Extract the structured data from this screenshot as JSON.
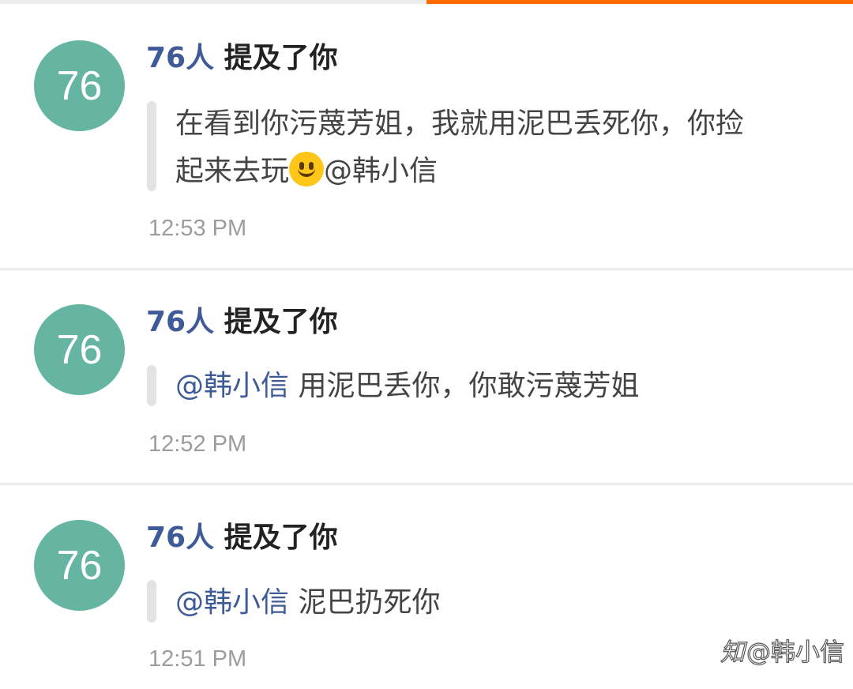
{
  "notifications": [
    {
      "avatar_text": "76",
      "user": "76人",
      "action": "提及了你",
      "message_lines": [
        "在看到你污蔑芳姐，我就用泥巴丢死你，你捡",
        "起来去玩"
      ],
      "message_emoji": "smiley-face",
      "message_suffix": "@韩小信",
      "time": "12:53 PM"
    },
    {
      "avatar_text": "76",
      "user": "76人",
      "action": "提及了你",
      "mention": "@韩小信",
      "message": " 用泥巴丢你，你敢污蔑芳姐",
      "time": "12:52 PM"
    },
    {
      "avatar_text": "76",
      "user": "76人",
      "action": "提及了你",
      "mention": "@韩小信",
      "message": " 泥巴扔死你",
      "time": "12:51 PM"
    }
  ],
  "watermark": {
    "logo": "知",
    "text": "@韩小信"
  },
  "colors": {
    "accent": "#ff6a00",
    "avatar": "#66b5a2",
    "username": "#3f5b97"
  }
}
